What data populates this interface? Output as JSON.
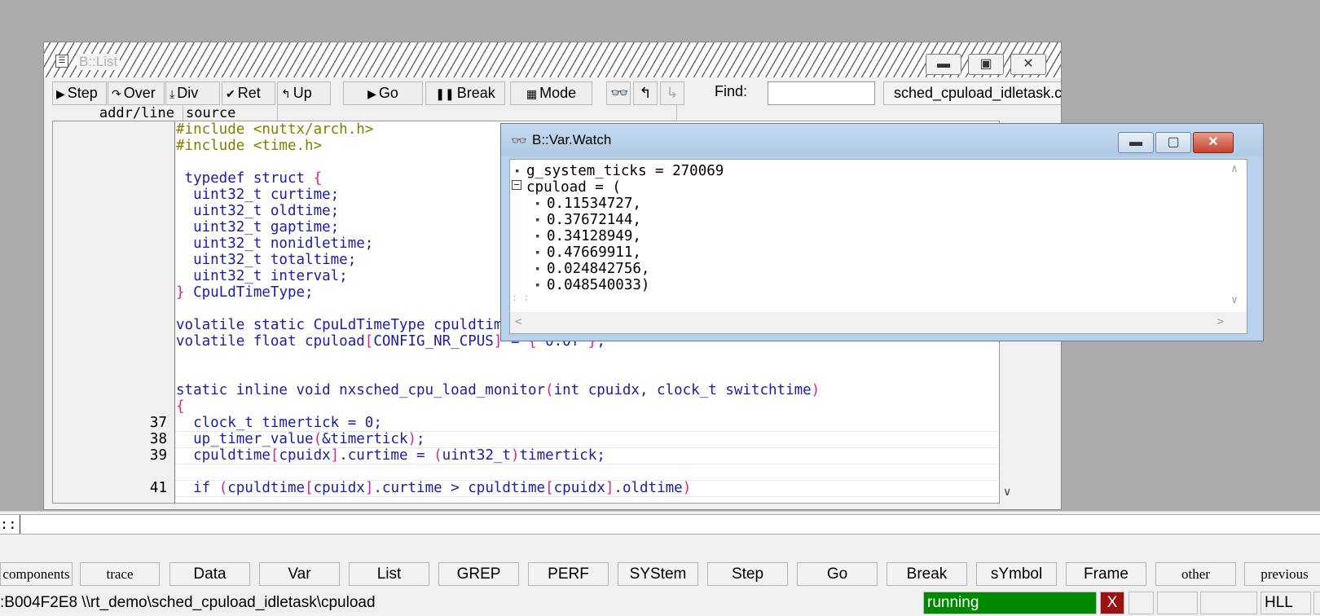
{
  "list_window": {
    "title": "B::List",
    "toolbar": {
      "step": "Step",
      "over": "Over",
      "div": "Div",
      "ret": "Ret",
      "up": "Up",
      "go": "Go",
      "break": "Break",
      "mode": "Mode",
      "find_label": "Find:",
      "find_value": "",
      "context": "sched_cpuload_idletask.c"
    },
    "columns": {
      "addr": "addr/line",
      "source": "source"
    },
    "lines": [
      {
        "ln": "",
        "code": "#include <nuttx/arch.h>"
      },
      {
        "ln": "",
        "code": "#include <time.h>"
      },
      {
        "ln": "",
        "code": ""
      },
      {
        "ln": "",
        "code": " typedef struct {"
      },
      {
        "ln": "",
        "code": "  uint32_t curtime;"
      },
      {
        "ln": "",
        "code": "  uint32_t oldtime;"
      },
      {
        "ln": "",
        "code": "  uint32_t gaptime;"
      },
      {
        "ln": "",
        "code": "  uint32_t nonidletime;"
      },
      {
        "ln": "",
        "code": "  uint32_t totaltime;"
      },
      {
        "ln": "",
        "code": "  uint32_t interval;"
      },
      {
        "ln": "",
        "code": "} CpuLdTimeType;"
      },
      {
        "ln": "",
        "code": ""
      },
      {
        "ln": "",
        "code": "volatile static CpuLdTimeType cpuldtime[CONFIG_NR_CPUS];"
      },
      {
        "ln": "",
        "code": "volatile float cpuload[CONFIG_NR_CPUS] = { 0.0f };"
      },
      {
        "ln": "",
        "code": ""
      },
      {
        "ln": "",
        "code": ""
      },
      {
        "ln": "",
        "code": "static inline void nxsched_cpu_load_monitor(int cpuidx, clock_t switchtime)"
      },
      {
        "ln": "",
        "code": "{"
      },
      {
        "ln": "37",
        "code": "  clock_t timertick = 0;"
      },
      {
        "ln": "38",
        "code": "  up_timer_value(&timertick);"
      },
      {
        "ln": "39",
        "code": "  cpuldtime[cpuidx].curtime = (uint32_t)timertick;"
      },
      {
        "ln": "",
        "code": ""
      },
      {
        "ln": "41",
        "code": "  if (cpuldtime[cpuidx].curtime > cpuldtime[cpuidx].oldtime)"
      }
    ]
  },
  "watch_window": {
    "title": "B::Var.Watch",
    "lines": [
      "g_system_ticks = 270069",
      "cpuload = (",
      "0.11534727,",
      "0.37672144,",
      "0.34128949,",
      "0.47669911,",
      "0.024842756,",
      "0.048540033)"
    ]
  },
  "command": {
    "prompt": "::",
    "value": ""
  },
  "softkeys": [
    "components",
    "trace",
    "Data",
    "Var",
    "List",
    "GREP",
    "PERF",
    "SYStem",
    "Step",
    "Go",
    "Break",
    "sYmbol",
    "Frame",
    "other",
    "previous"
  ],
  "status": {
    "path": ":B004F2E8  \\\\rt_demo\\sched_cpuload_idletask\\cpuload",
    "state": "running",
    "x": "X",
    "mode": "HLL"
  },
  "colors": {
    "running": "#008a00",
    "keyword": "#1c1ca8",
    "preprocessor": "#808000",
    "bracket": "#e0208a"
  }
}
